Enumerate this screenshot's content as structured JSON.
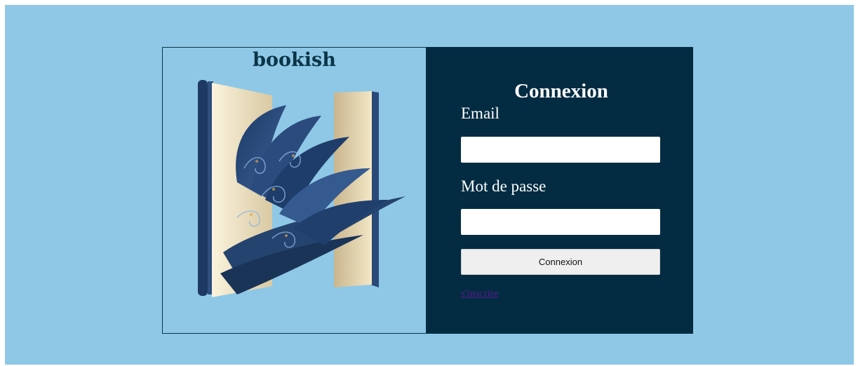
{
  "brand": {
    "name": "bookish"
  },
  "illustration": {
    "icon": "open-book-illustration-icon"
  },
  "login_form": {
    "title": "Connexion",
    "email_label": "Email",
    "email_value": "",
    "password_label": "Mot de passe",
    "password_value": "",
    "submit_label": "Connexion",
    "signup_link": "s'inscrire"
  },
  "colors": {
    "page_background": "#8ec8e6",
    "form_panel": "#032c42",
    "brand_text": "#0b3447",
    "visited_link": "#551a8b"
  }
}
